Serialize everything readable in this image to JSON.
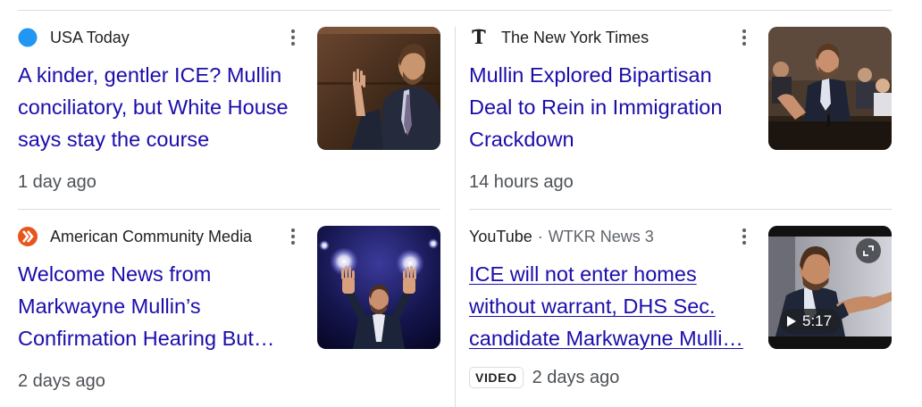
{
  "colors": {
    "link": "#1a0dab",
    "text": "#202124",
    "muted": "#4d5156",
    "divider": "#dadce0",
    "usa_today_dot": "#2196f3"
  },
  "cards": [
    {
      "source": "USA Today",
      "favicon": "usa-today-blue-dot-icon",
      "headline_lines": [
        "A kinder, gentler ICE? Mullin",
        "conciliatory, but White House",
        "says stay the course"
      ],
      "time": "1 day ago",
      "menu_icon": "more-vert-icon"
    },
    {
      "source": "The New York Times",
      "favicon": "nyt-logo-icon",
      "headline_lines": [
        "Mullin Explored Bipartisan",
        "Deal to Rein in Immigration",
        "Crackdown"
      ],
      "time": "14 hours ago",
      "menu_icon": "more-vert-icon"
    },
    {
      "source": "American Community Media",
      "favicon": "acm-orange-chevron-icon",
      "headline_lines": [
        "Welcome News from",
        "Markwayne Mullin’s",
        "Confirmation Hearing But…"
      ],
      "time": "2 days ago",
      "menu_icon": "more-vert-icon"
    },
    {
      "source": "YouTube",
      "source_separator": "·",
      "source_channel": "WTKR News 3",
      "headline_lines": [
        "ICE will not enter homes",
        "without warrant, DHS Sec.",
        "candidate Markwayne Mulli…"
      ],
      "badge": "VIDEO",
      "time": "2 days ago",
      "duration": "5:17",
      "menu_icon": "more-vert-icon",
      "expand_icon": "expand-icon"
    }
  ]
}
